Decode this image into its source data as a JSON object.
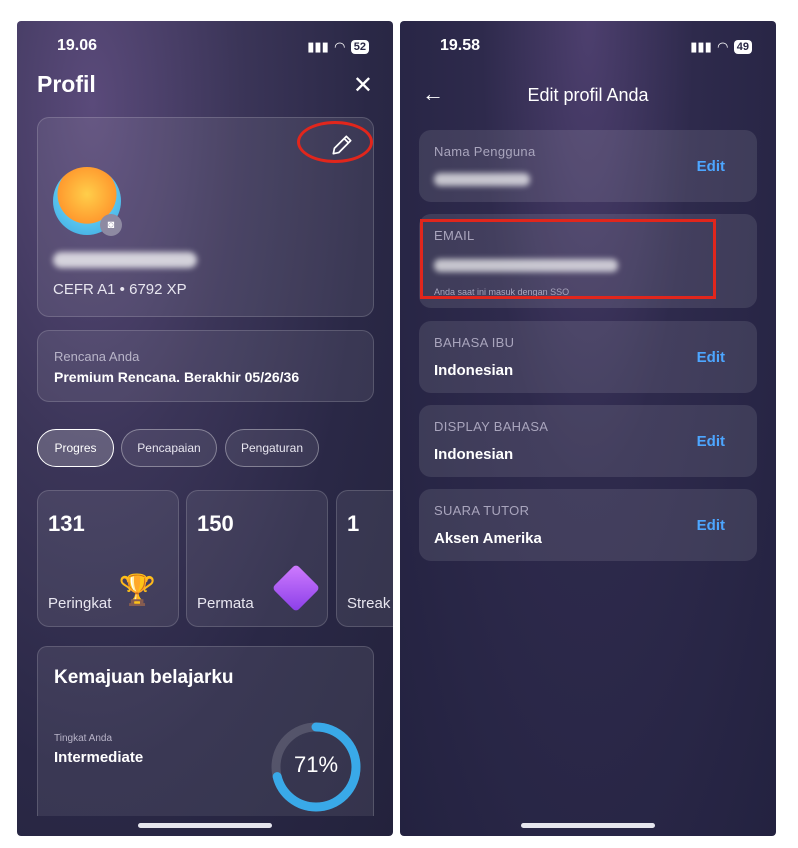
{
  "left_screen": {
    "status": {
      "time": "19.06",
      "battery": "52"
    },
    "title": "Profil",
    "profile": {
      "level_xp": "CEFR A1 • 6792 XP"
    },
    "plan": {
      "label": "Rencana Anda",
      "value": "Premium Rencana. Berakhir 05/26/36"
    },
    "tabs": [
      {
        "label": "Progres"
      },
      {
        "label": "Pencapaian"
      },
      {
        "label": "Pengaturan"
      }
    ],
    "stats": [
      {
        "value": "131",
        "label": "Peringkat",
        "icon": "trophy-icon"
      },
      {
        "value": "150",
        "label": "Permata",
        "icon": "gem-icon"
      },
      {
        "value": "1",
        "label": "Streak"
      }
    ],
    "progress": {
      "heading": "Kemajuan belajarku",
      "level_label": "Tingkat Anda",
      "level_value": "Intermediate",
      "percent": "71%",
      "fraction": 0.71
    }
  },
  "right_screen": {
    "status": {
      "time": "19.58",
      "battery": "49"
    },
    "title": "Edit profil Anda",
    "rows": [
      {
        "key": "Nama Pengguna",
        "edit": "Edit"
      },
      {
        "key": "EMAIL",
        "note": "Anda saat ini masuk dengan SSO"
      },
      {
        "key": "BAHASA IBU",
        "value": "Indonesian",
        "edit": "Edit"
      },
      {
        "key": "DISPLAY BAHASA",
        "value": "Indonesian",
        "edit": "Edit"
      },
      {
        "key": "SUARA TUTOR",
        "value": "Aksen Amerika",
        "edit": "Edit"
      }
    ]
  },
  "colors": {
    "accent": "#4da6ff",
    "highlight": "#e1261c",
    "ring": "#39a9e8"
  }
}
